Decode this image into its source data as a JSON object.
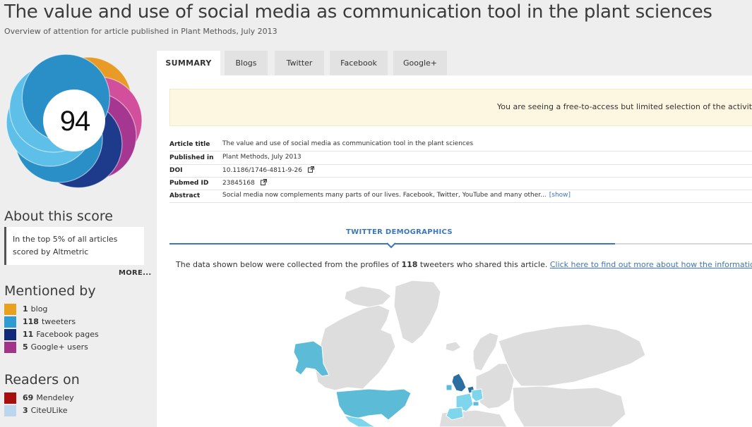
{
  "page": {
    "title": "The value and use of social media as communication tool in the plant sciences",
    "subtitle": "Overview of attention for article published in Plant Methods, July 2013"
  },
  "score": {
    "value": "94",
    "donut_colors": [
      "#e89b27",
      "#d24f9b",
      "#a63790",
      "#1e3a8a",
      "#2a8fc6",
      "#5ec0e8"
    ]
  },
  "about": {
    "heading": "About this score",
    "text": "In the top 5% of all articles scored by Altmetric",
    "more": "MORE..."
  },
  "mentioned": {
    "heading": "Mentioned by",
    "items": [
      {
        "count": "1",
        "label": "blog",
        "color": "#e8a01f"
      },
      {
        "count": "118",
        "label": "tweeters",
        "color": "#2e9bd3"
      },
      {
        "count": "11",
        "label": "Facebook pages",
        "color": "#102a79"
      },
      {
        "count": "5",
        "label": "Google+ users",
        "color": "#a13388"
      }
    ]
  },
  "readers": {
    "heading": "Readers on",
    "items": [
      {
        "count": "69",
        "label": "Mendeley",
        "color": "#a80e0e"
      },
      {
        "count": "3",
        "label": "CiteULike",
        "color": "#bcd6ee"
      }
    ]
  },
  "tabs": [
    {
      "label": "SUMMARY",
      "active": true
    },
    {
      "label": "Blogs"
    },
    {
      "label": "Twitter"
    },
    {
      "label": "Facebook"
    },
    {
      "label": "Google+"
    }
  ],
  "banner": {
    "text": "You are seeing a free-to-access but limited selection of the activity Altmetric"
  },
  "article": {
    "rows": [
      {
        "key": "Article title",
        "value": "The value and use of social media as communication tool in the plant sciences"
      },
      {
        "key": "Published in",
        "value": "Plant Methods, July 2013"
      },
      {
        "key": "DOI",
        "value": "10.1186/1746-4811-9-26"
      },
      {
        "key": "Pubmed ID",
        "value": "23845168"
      },
      {
        "key": "Abstract",
        "value": "Social media now complements many parts of our lives. Facebook, Twitter, YouTube and many other...",
        "link": "[show]"
      }
    ]
  },
  "demographics": {
    "title": "TWITTER DEMOGRAPHICS",
    "desc_before": "The data shown below were collected from the profiles of ",
    "desc_count": "118",
    "desc_after": " tweeters who shared this article. ",
    "desc_link": "Click here to find out more about how the information was compiled.",
    "map_colors": {
      "land": "#dddddd",
      "low": "#7fd6ec",
      "mid": "#5cbcd8",
      "high": "#2a6f9f",
      "border": "#ffffff"
    }
  }
}
